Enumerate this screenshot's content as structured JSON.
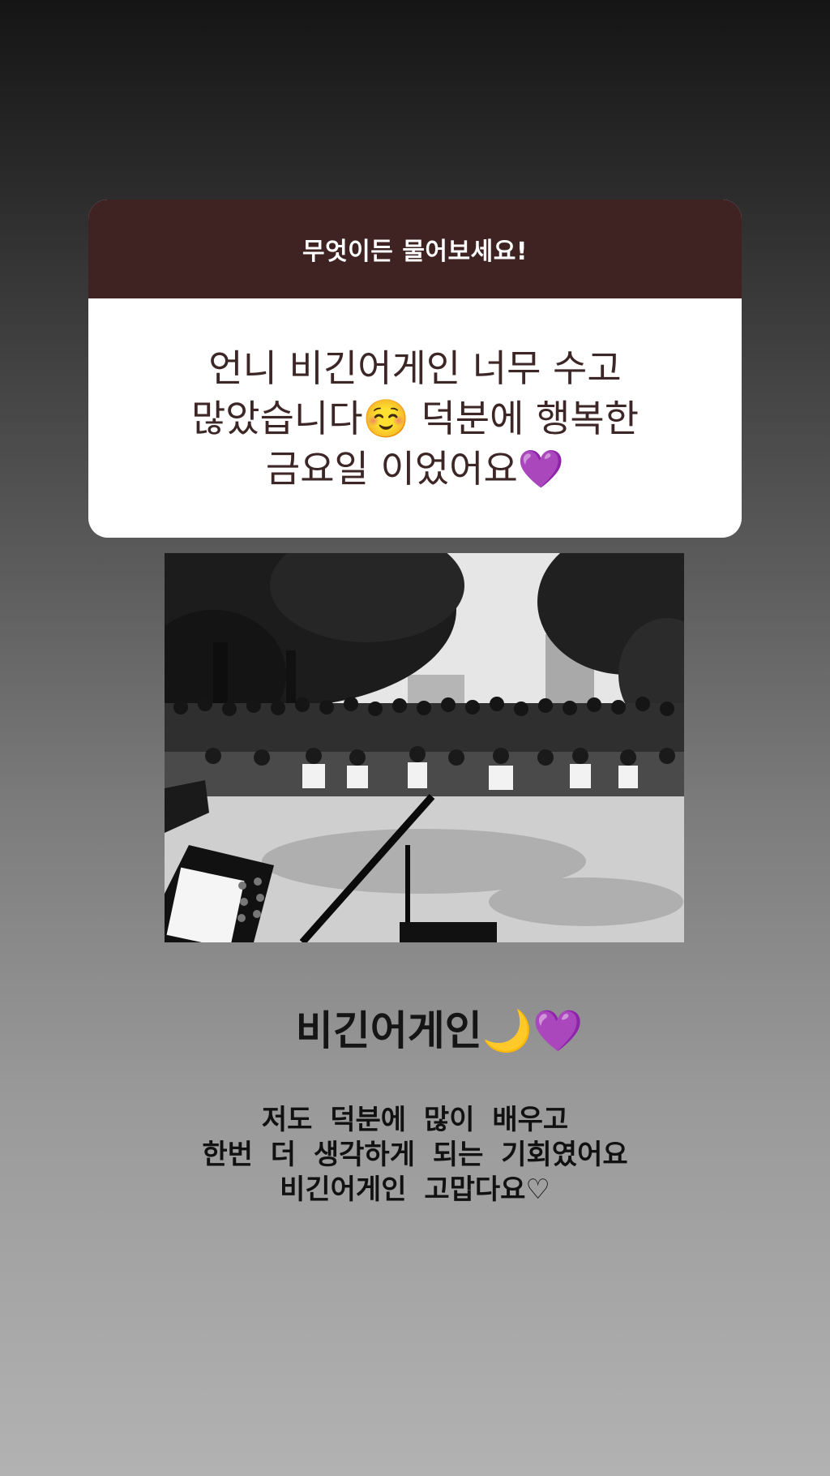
{
  "question_sticker": {
    "title": "무엇이든 물어보세요!",
    "answer": "언니 비긴어게인 너무 수고 많았습니다☺️ 덕분에 행복한 금요일 이었어요💜"
  },
  "caption": {
    "title": "비긴어게인🌙💜",
    "lines": [
      "저도 덕분에 많이 배우고",
      "한번 더 생각하게 되는 기회였어요",
      "비긴어게인 고맙다요♡"
    ]
  },
  "colors": {
    "sticker_header": "#3f2222",
    "sticker_text": "#3d2626",
    "caption_text": "#111111"
  }
}
